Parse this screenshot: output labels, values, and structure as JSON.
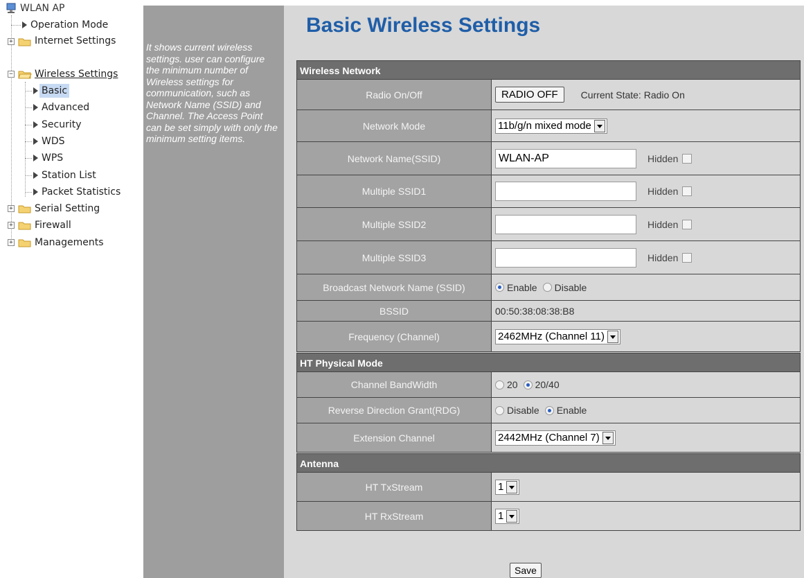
{
  "tree": {
    "root": "WLAN AP",
    "items": [
      {
        "label": "Operation Mode"
      },
      {
        "label": "Internet Settings"
      },
      {
        "label": "Wireless Settings"
      },
      {
        "label": "Basic"
      },
      {
        "label": "Advanced"
      },
      {
        "label": "Security"
      },
      {
        "label": "WDS"
      },
      {
        "label": "WPS"
      },
      {
        "label": "Station List"
      },
      {
        "label": "Packet Statistics"
      },
      {
        "label": "Serial Setting"
      },
      {
        "label": "Firewall"
      },
      {
        "label": "Managements"
      }
    ]
  },
  "help": {
    "text": "It shows current wireless settings. user can configure the minimum number of Wireless settings for communication, such as Network Name (SSID) and Channel. The Access Point can be set simply with only the minimum setting items."
  },
  "page": {
    "title": "Basic Wireless Settings"
  },
  "wireless_network": {
    "header": "Wireless Network",
    "radio_label": "Radio On/Off",
    "radio_button": "RADIO OFF",
    "radio_state": "Current State: Radio On",
    "mode_label": "Network Mode",
    "mode_value": "11b/g/n mixed mode",
    "ssid_label": "Network Name(SSID)",
    "ssid_value": "WLAN-AP",
    "hidden_label": "Hidden",
    "mssid1_label": "Multiple SSID1",
    "mssid2_label": "Multiple SSID2",
    "mssid3_label": "Multiple SSID3",
    "broadcast_label": "Broadcast Network Name (SSID)",
    "enable": "Enable",
    "disable": "Disable",
    "bssid_label": "BSSID",
    "bssid_value": "00:50:38:08:38:B8",
    "freq_label": "Frequency (Channel)",
    "freq_value": "2462MHz (Channel 11)"
  },
  "ht": {
    "header": "HT Physical Mode",
    "bw_label": "Channel BandWidth",
    "bw_20": "20",
    "bw_2040": "20/40",
    "rdg_label": "Reverse Direction Grant(RDG)",
    "rdg_disable": "Disable",
    "rdg_enable": "Enable",
    "ext_label": "Extension Channel",
    "ext_value": "2442MHz (Channel 7)"
  },
  "antenna": {
    "header": "Antenna",
    "tx_label": "HT TxStream",
    "tx_value": "1",
    "rx_label": "HT RxStream",
    "rx_value": "1"
  },
  "save_label": "Save"
}
